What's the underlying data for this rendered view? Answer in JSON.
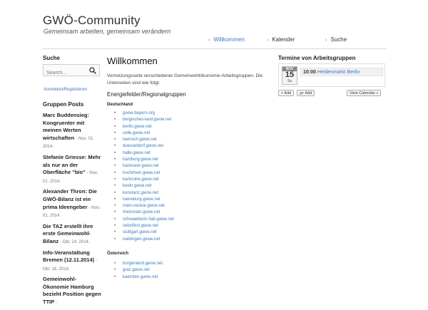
{
  "site": {
    "title": "GWÖ-Community",
    "tagline": "Gemeinsam arbeiten, gemeinsam verändern"
  },
  "nav": {
    "items": [
      {
        "label": "Willkommen",
        "active": true
      },
      {
        "label": "Kalender",
        "active": false
      },
      {
        "label": "Suche",
        "active": false
      }
    ],
    "bullet": "›"
  },
  "sidebar": {
    "search_heading": "Suche",
    "search_placeholder": "Search...",
    "search_icon": "magnifier-icon",
    "login_link": "Anmelden/Registrieren",
    "posts_heading": "Gruppen Posts",
    "posts": [
      {
        "title": "Marc Buddensieg: Kongruenter mit meinen Werten wirtschaften",
        "date": "- Nov. 01. 2014."
      },
      {
        "title": "Stefanie Griesse: Mehr als nur an der Oberfläche \"bio\"",
        "date": "- Nov. 01. 2014."
      },
      {
        "title": "Alexander Thron: Die GWÖ-Bilanz ist ein prima Ideengeber",
        "date": "- Nov. 01. 2014."
      },
      {
        "title": "Die TAZ erstellt ihre erste Gemeinwohl-Bilanz",
        "date": "- Okt. 24. 2014."
      },
      {
        "title": "Info-Veranstaltung Bremen (12.11.2014)",
        "date": "- Okt. 16. 2014."
      },
      {
        "title": "Gemeinwohl-Ökonomie Hamburg bezieht Position gegen TTIP",
        "date": "-"
      }
    ]
  },
  "main": {
    "title": "Willkommen",
    "description": "Vernetzungsseite verschiedener Gemeinwohlökonomie-Arbeitsgruppen. Die Unterseiten sind wie folgt.",
    "subheading": "Energiefelder/Regionalgruppen",
    "regions": [
      {
        "name": "Deutschland",
        "links": [
          "gwoe-bayern.org",
          "bergisches-land.gwoe.net",
          "berlin.gwoe.net",
          "celle.gwoe.net",
          "loerrach.gwoe.net",
          "duesseldorf.gwoe.net",
          "halle.gwoe.net",
          "hamburg.gwoe.net",
          "hannover.gwoe.net",
          "hochrhein.gwoe.net",
          "karlsruhe.gwoe.net",
          "koeln.gwoe.net",
          "konstanz.gwoe.net",
          "lueneburg.gwoe.net",
          "main-neckar.gwoe.net",
          "rheinmain.gwoe.net",
          "schwaebisch-hall.gwoe.net",
          "sebstfest.gwoe.net",
          "stuttgart.gwoe.net",
          "tuebingen.gwoe.net"
        ]
      },
      {
        "name": "Österreich",
        "links": [
          "burgenland.gwoe.net",
          "graz.gwoe.net",
          "kaernten.gwoe.net"
        ]
      }
    ]
  },
  "right": {
    "heading": "Termine von Arbeitsgruppen",
    "calendar": {
      "month": "NOV",
      "day": "15",
      "weekday": "Sa",
      "event_time": "10:00",
      "event_title": "Heldenmarkt Berlin"
    },
    "add_label": "+ Add",
    "gplus_label": "g+ Add",
    "view_label": "View Calendar »"
  },
  "colors": {
    "link": "#3a7bbf",
    "separator": "#d9d9d9"
  }
}
